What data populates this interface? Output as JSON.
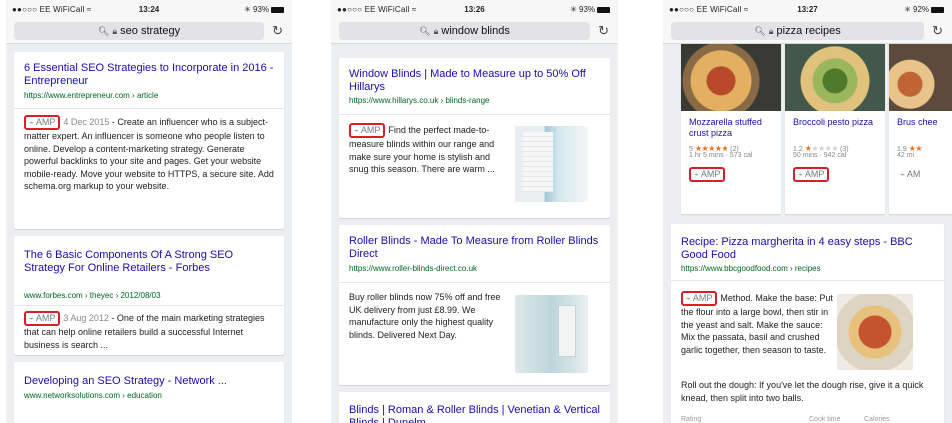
{
  "screens": [
    {
      "status": {
        "carrier": "●●○○○ EE WiFiCall ≈",
        "time": "13:24",
        "battery": "✳ 93%"
      },
      "url_bar": {
        "query": "seo strategy",
        "search_icon": "search-icon",
        "lock_icon": "lock-icon"
      },
      "results": [
        {
          "title": "6 Essential SEO Strategies to Incorporate in 2016 - Entrepreneur",
          "url": "https://www.entrepreneur.com › article",
          "amp_label": "AMP",
          "date": "4 Dec 2015",
          "snippet": "- Create an influencer who is a subject-matter expert. An influencer is someone who people listen to online. Develop a content-marketing strategy. Generate powerful backlinks to your site and pages. Get your website mobile-ready. Move your website to HTTPS, a secure site. Add schema.org markup to your website."
        },
        {
          "title": "The 6 Basic Components Of A Strong SEO Strategy For Online Retailers - Forbes",
          "url": "www.forbes.com › theyec › 2012/08/03",
          "amp_label": "AMP",
          "date": "3 Aug 2012",
          "snippet": "- One of the main marketing strategies that can help online retailers build a successful Internet business is search ..."
        },
        {
          "title": "Developing an SEO Strategy - Network ...",
          "url": "www.networksolutions.com › education"
        }
      ]
    },
    {
      "status": {
        "carrier": "●●○○○ EE WiFiCall ≈",
        "time": "13:26",
        "battery": "✳ 93%"
      },
      "url_bar": {
        "query": "window blinds"
      },
      "results": [
        {
          "title": "Window Blinds | Made to Measure up to 50% Off Hillarys",
          "url": "https://www.hillarys.co.uk › blinds-range",
          "amp_label": "AMP",
          "snippet": "Find the perfect made-to-measure blinds within our range and make sure your home is stylish and snug this season. There are warm ..."
        },
        {
          "title": "Roller Blinds - Made To Measure from Roller Blinds Direct",
          "url": "https://www.roller-blinds-direct.co.uk",
          "snippet": "Buy roller blinds now 75% off and free UK delivery from just £8.99. We manufacture only the highest quality blinds. Delivered Next Day."
        },
        {
          "title": "Blinds | Roman & Roller Blinds | Venetian & Vertical Blinds | Dunelm"
        }
      ]
    },
    {
      "status": {
        "carrier": "●●○○○ EE WiFiCall ≈",
        "time": "13:27",
        "battery": "✳ 92%"
      },
      "url_bar": {
        "query": "pizza recipes"
      },
      "recipes": [
        {
          "title": "Mozzarella stuffed crust pizza",
          "rating": "5",
          "stars_filled": 5,
          "reviews": "(2)",
          "meta": "1 hr 5 mins · 573 cal",
          "amp_label": "AMP"
        },
        {
          "title": "Broccoli pesto pizza",
          "rating": "1.2",
          "stars_filled": 1,
          "reviews": "(3)",
          "meta": "50 mins · 942 cal",
          "amp_label": "AMP"
        },
        {
          "title": "Brus chee",
          "rating": "1.9",
          "meta": "42 mi",
          "amp_label": "AM"
        }
      ],
      "result": {
        "title": "Recipe: Pizza margherita in 4 easy steps - BBC Good Food",
        "url": "https://www.bbcgoodfood.com › recipes",
        "amp_label": "AMP",
        "snippet": "Method. Make the base: Put the flour into a large bowl, then stir in the yeast and salt. Make the sauce: Mix the passata, basil and crushed garlic together, then season to taste.",
        "snippet2": "Roll out the dough: If you've let the dough rise, give it a quick knead, then split into two balls.",
        "footer": {
          "rating": "Rating",
          "cook_time": "Cook time",
          "calories": "Calories"
        }
      }
    }
  ],
  "colors": {
    "amp_highlight": "#d3202a",
    "link": "#1a0dab",
    "url": "#006621",
    "star": "#e7711b"
  }
}
